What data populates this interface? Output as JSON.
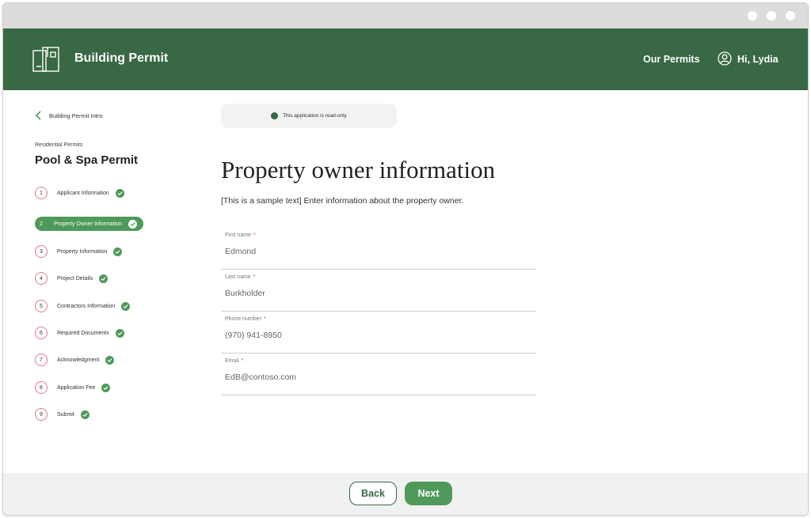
{
  "header": {
    "app_title": "Building Permit",
    "nav_link": "Our Permits",
    "greeting": "Hi, Lydia"
  },
  "sidebar": {
    "back_link": "Building Permit Intro",
    "caption": "Residential Permits",
    "permit_title": "Pool & Spa Permit",
    "steps": [
      {
        "number": "1",
        "label": "Applicant Information",
        "completed": true,
        "active": false
      },
      {
        "number": "2",
        "label": "Property Owner Information",
        "completed": true,
        "active": true
      },
      {
        "number": "3",
        "label": "Property Information",
        "completed": true,
        "active": false
      },
      {
        "number": "4",
        "label": "Project Details",
        "completed": true,
        "active": false
      },
      {
        "number": "5",
        "label": "Contractors Information",
        "completed": true,
        "active": false
      },
      {
        "number": "6",
        "label": "Required Documents",
        "completed": true,
        "active": false
      },
      {
        "number": "7",
        "label": "Acknowledgment",
        "completed": true,
        "active": false
      },
      {
        "number": "8",
        "label": "Application Fee",
        "completed": true,
        "active": false
      },
      {
        "number": "9",
        "label": "Submit",
        "completed": true,
        "active": false
      }
    ]
  },
  "main": {
    "notice": "This application is read-only",
    "heading": "Property owner information",
    "intro": "[This is a sample text] Enter information about the property owner.",
    "fields": [
      {
        "label": "First name",
        "required": "*",
        "value": "Edmond"
      },
      {
        "label": "Last name",
        "required": "*",
        "value": "Burkholder"
      },
      {
        "label": "Phone number",
        "required": "*",
        "value": "(970) 941-8950"
      },
      {
        "label": "Email",
        "required": "*",
        "value": "EdB@contoso.com"
      }
    ]
  },
  "footer": {
    "back_label": "Back",
    "next_label": "Next"
  },
  "colors": {
    "brand_green": "#386844",
    "accent_green": "#4f9a5a",
    "step_ring": "#e07a8a",
    "required_marker": "#d0434a"
  }
}
